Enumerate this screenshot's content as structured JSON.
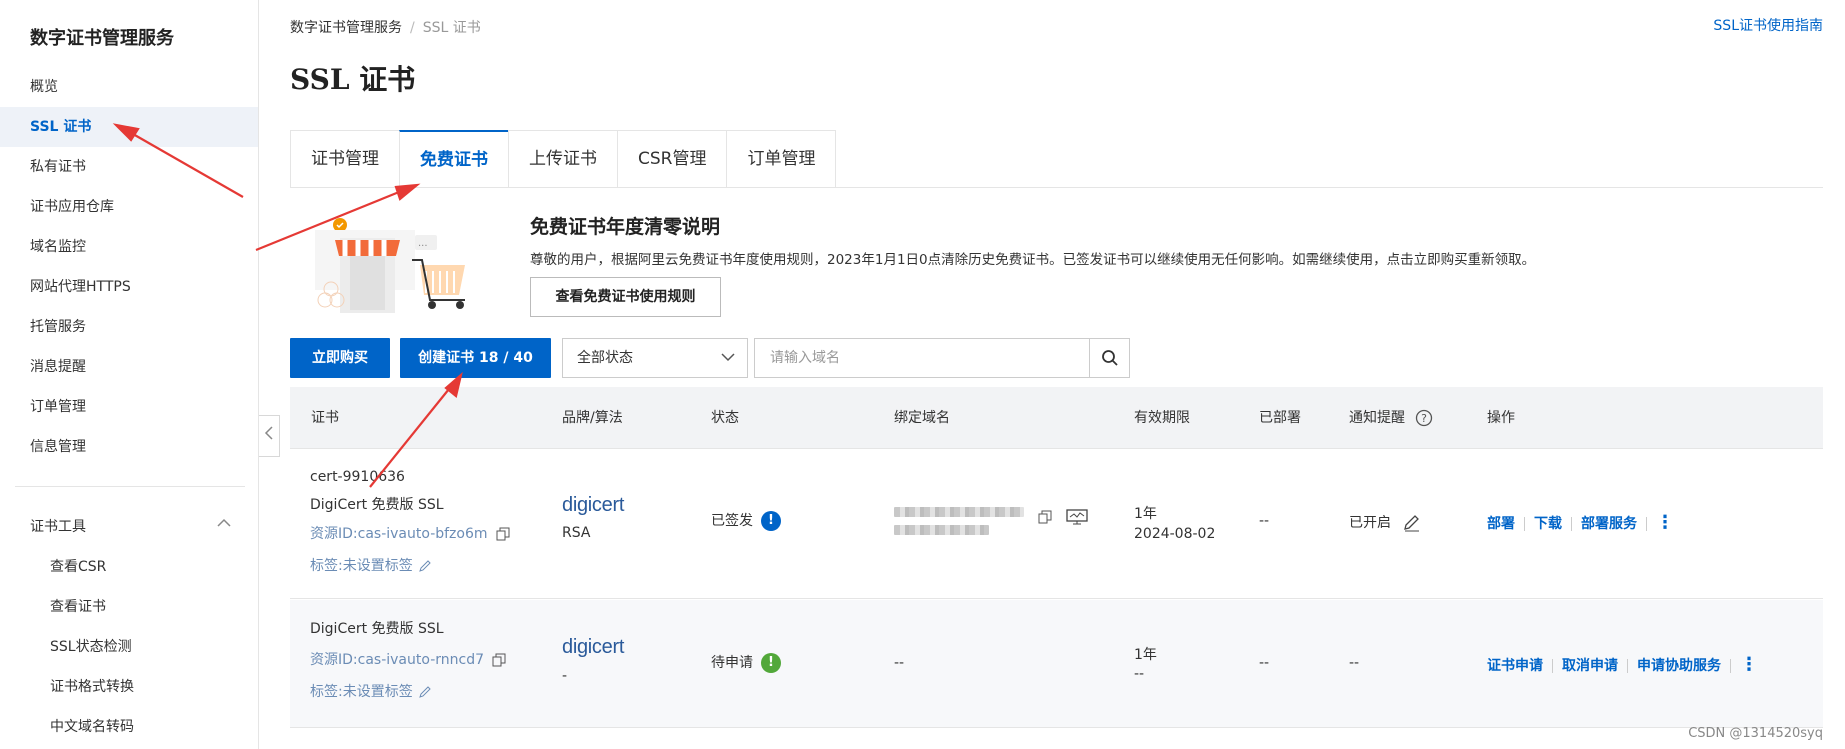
{
  "sidebar": {
    "title": "数字证书管理服务",
    "items": [
      {
        "label": "概览"
      },
      {
        "label": "SSL 证书"
      },
      {
        "label": "私有证书"
      },
      {
        "label": "证书应用仓库"
      },
      {
        "label": "域名监控"
      },
      {
        "label": "网站代理HTTPS"
      },
      {
        "label": "托管服务"
      },
      {
        "label": "消息提醒"
      },
      {
        "label": "订单管理"
      },
      {
        "label": "信息管理"
      }
    ],
    "group": {
      "label": "证书工具",
      "items": [
        {
          "label": "查看CSR"
        },
        {
          "label": "查看证书"
        },
        {
          "label": "SSL状态检测"
        },
        {
          "label": "证书格式转换"
        },
        {
          "label": "中文域名转码"
        }
      ]
    }
  },
  "header": {
    "breadcrumb_root": "数字证书管理服务",
    "breadcrumb_sep": "/",
    "breadcrumb_current": "SSL 证书",
    "guide_link": "SSL证书使用指南",
    "title": "SSL 证书"
  },
  "tabs": [
    {
      "label": "证书管理"
    },
    {
      "label": "免费证书"
    },
    {
      "label": "上传证书"
    },
    {
      "label": "CSR管理"
    },
    {
      "label": "订单管理"
    }
  ],
  "banner": {
    "title": "免费证书年度清零说明",
    "description": "尊敬的用户，根据阿里云免费证书年度使用规则，2023年1月1日0点清除历史免费证书。已签发证书可以继续使用无任何影响。如需继续使用，点击立即购买重新领取。",
    "button": "查看免费证书使用规则"
  },
  "toolbar": {
    "buy_button": "立即购买",
    "create_button": "创建证书 18 / 40",
    "status_select": "全部状态",
    "search_placeholder": "请输入域名"
  },
  "table": {
    "headers": [
      "证书",
      "品牌/算法",
      "状态",
      "绑定域名",
      "有效期限",
      "已部署",
      "通知提醒",
      "操作"
    ],
    "rows": [
      {
        "cert_name": "cert-9910636",
        "product": "DigiCert 免费版 SSL",
        "resource_id": "资源ID:cas-ivauto-bfzo6m",
        "tags": "标签:未设置标签",
        "brand": "digicert",
        "algorithm": "RSA",
        "status": "已签发",
        "status_color": "#0064c8",
        "validity_term": "1年",
        "validity_date": "2024-08-02",
        "deployed": "--",
        "notify": "已开启",
        "actions": [
          "部署",
          "下载",
          "部署服务"
        ]
      },
      {
        "cert_name": "",
        "product": "DigiCert 免费版 SSL",
        "resource_id": "资源ID:cas-ivauto-rnncd7",
        "tags": "标签:未设置标签",
        "brand": "digicert",
        "algorithm": "-",
        "status": "待申请",
        "status_color": "#52a83a",
        "domain": "--",
        "validity_term": "1年",
        "validity_date": "--",
        "deployed": "--",
        "notify": "--",
        "actions": [
          "证书申请",
          "取消申请",
          "申请协助服务"
        ]
      }
    ]
  },
  "watermark": "CSDN @1314520syq",
  "colors": {
    "accent": "#0064c8",
    "arrow": "#e53935"
  }
}
